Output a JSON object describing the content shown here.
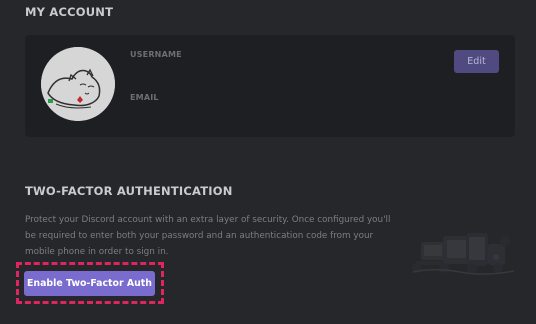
{
  "my_account": {
    "title": "MY ACCOUNT",
    "username_label": "USERNAME",
    "email_label": "EMAIL",
    "edit_label": "Edit"
  },
  "two_factor": {
    "title": "TWO-FACTOR AUTHENTICATION",
    "description": "Protect your Discord account with an extra layer of security. Once configured you'll be required to enter both your password and an authentication code from your mobile phone in order to sign in.",
    "button_label": "Enable Two-Factor Auth"
  },
  "colors": {
    "background": "#26272b",
    "card": "#1e1f23",
    "accent": "#7a6ccf",
    "highlight": "#e0245e"
  },
  "icons": {
    "avatar": "cat-avatar-icon",
    "illustration": "devices-illustration-icon"
  }
}
